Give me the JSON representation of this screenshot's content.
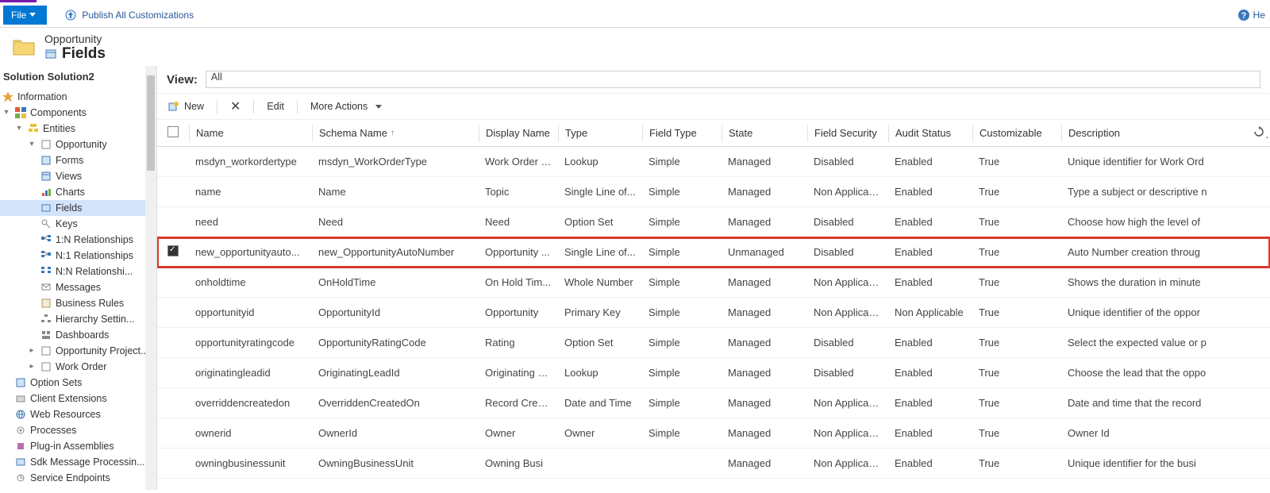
{
  "ribbon": {
    "file": "File",
    "publish": "Publish All Customizations",
    "help": "He"
  },
  "header": {
    "breadcrumb": "Opportunity",
    "title": "Fields"
  },
  "solution_title": "Solution Solution2",
  "tree": {
    "information": "Information",
    "components": "Components",
    "entities": "Entities",
    "opportunity": "Opportunity",
    "forms": "Forms",
    "views": "Views",
    "charts": "Charts",
    "fields": "Fields",
    "keys": "Keys",
    "rel_1n": "1:N Relationships",
    "rel_n1": "N:1 Relationships",
    "rel_nn": "N:N Relationshi...",
    "messages": "Messages",
    "business_rules": "Business Rules",
    "hierarchy": "Hierarchy Settin...",
    "dashboards": "Dashboards",
    "opp_project": "Opportunity Project...",
    "work_order": "Work Order",
    "option_sets": "Option Sets",
    "client_ext": "Client Extensions",
    "web_resources": "Web Resources",
    "processes": "Processes",
    "plugin": "Plug-in Assemblies",
    "sdk": "Sdk Message Processin...",
    "svc_endpoints": "Service Endpoints"
  },
  "view": {
    "label": "View:",
    "value": "All"
  },
  "toolbar": {
    "new": "New",
    "edit": "Edit",
    "more": "More Actions"
  },
  "columns": {
    "name": "Name",
    "schema": "Schema Name",
    "display": "Display Name",
    "type": "Type",
    "fieldtype": "Field Type",
    "state": "State",
    "fsec": "Field Security",
    "audit": "Audit Status",
    "cust": "Customizable",
    "desc": "Description"
  },
  "rows": [
    {
      "checked": false,
      "name": "msdyn_workordertype",
      "schema": "msdyn_WorkOrderType",
      "display": "Work Order T...",
      "type": "Lookup",
      "ftype": "Simple",
      "state": "Managed",
      "fsec": "Disabled",
      "audit": "Enabled",
      "cust": "True",
      "desc": "Unique identifier for Work Ord",
      "hl": false
    },
    {
      "checked": false,
      "name": "name",
      "schema": "Name",
      "display": "Topic",
      "type": "Single Line of...",
      "ftype": "Simple",
      "state": "Managed",
      "fsec": "Non Applicable",
      "audit": "Enabled",
      "cust": "True",
      "desc": "Type a subject or descriptive n",
      "hl": false
    },
    {
      "checked": false,
      "name": "need",
      "schema": "Need",
      "display": "Need",
      "type": "Option Set",
      "ftype": "Simple",
      "state": "Managed",
      "fsec": "Disabled",
      "audit": "Enabled",
      "cust": "True",
      "desc": "Choose how high the level of",
      "hl": false
    },
    {
      "checked": true,
      "name": "new_opportunityauto...",
      "schema": "new_OpportunityAutoNumber",
      "display": "Opportunity ...",
      "type": "Single Line of...",
      "ftype": "Simple",
      "state": "Unmanaged",
      "fsec": "Disabled",
      "audit": "Enabled",
      "cust": "True",
      "desc": "Auto Number creation throug",
      "hl": true
    },
    {
      "checked": false,
      "name": "onholdtime",
      "schema": "OnHoldTime",
      "display": "On Hold Tim...",
      "type": "Whole Number",
      "ftype": "Simple",
      "state": "Managed",
      "fsec": "Non Applicable",
      "audit": "Enabled",
      "cust": "True",
      "desc": "Shows the duration in minute",
      "hl": false
    },
    {
      "checked": false,
      "name": "opportunityid",
      "schema": "OpportunityId",
      "display": "Opportunity",
      "type": "Primary Key",
      "ftype": "Simple",
      "state": "Managed",
      "fsec": "Non Applicable",
      "audit": "Non Applicable",
      "cust": "True",
      "desc": "Unique identifier of the oppor",
      "hl": false
    },
    {
      "checked": false,
      "name": "opportunityratingcode",
      "schema": "OpportunityRatingCode",
      "display": "Rating",
      "type": "Option Set",
      "ftype": "Simple",
      "state": "Managed",
      "fsec": "Disabled",
      "audit": "Enabled",
      "cust": "True",
      "desc": "Select the expected value or p",
      "hl": false
    },
    {
      "checked": false,
      "name": "originatingleadid",
      "schema": "OriginatingLeadId",
      "display": "Originating L...",
      "type": "Lookup",
      "ftype": "Simple",
      "state": "Managed",
      "fsec": "Disabled",
      "audit": "Enabled",
      "cust": "True",
      "desc": "Choose the lead that the oppo",
      "hl": false
    },
    {
      "checked": false,
      "name": "overriddencreatedon",
      "schema": "OverriddenCreatedOn",
      "display": "Record Creat...",
      "type": "Date and Time",
      "ftype": "Simple",
      "state": "Managed",
      "fsec": "Non Applicable",
      "audit": "Enabled",
      "cust": "True",
      "desc": "Date and time that the record",
      "hl": false
    },
    {
      "checked": false,
      "name": "ownerid",
      "schema": "OwnerId",
      "display": "Owner",
      "type": "Owner",
      "ftype": "Simple",
      "state": "Managed",
      "fsec": "Non Applicable",
      "audit": "Enabled",
      "cust": "True",
      "desc": "Owner Id",
      "hl": false
    },
    {
      "checked": false,
      "name": "owningbusinessunit",
      "schema": "OwningBusinessUnit",
      "display": "Owning Busi",
      "type": "",
      "ftype": "",
      "state": "Managed",
      "fsec": "Non Applicable",
      "audit": "Enabled",
      "cust": "True",
      "desc": "Unique identifier for the busi",
      "hl": false
    }
  ]
}
